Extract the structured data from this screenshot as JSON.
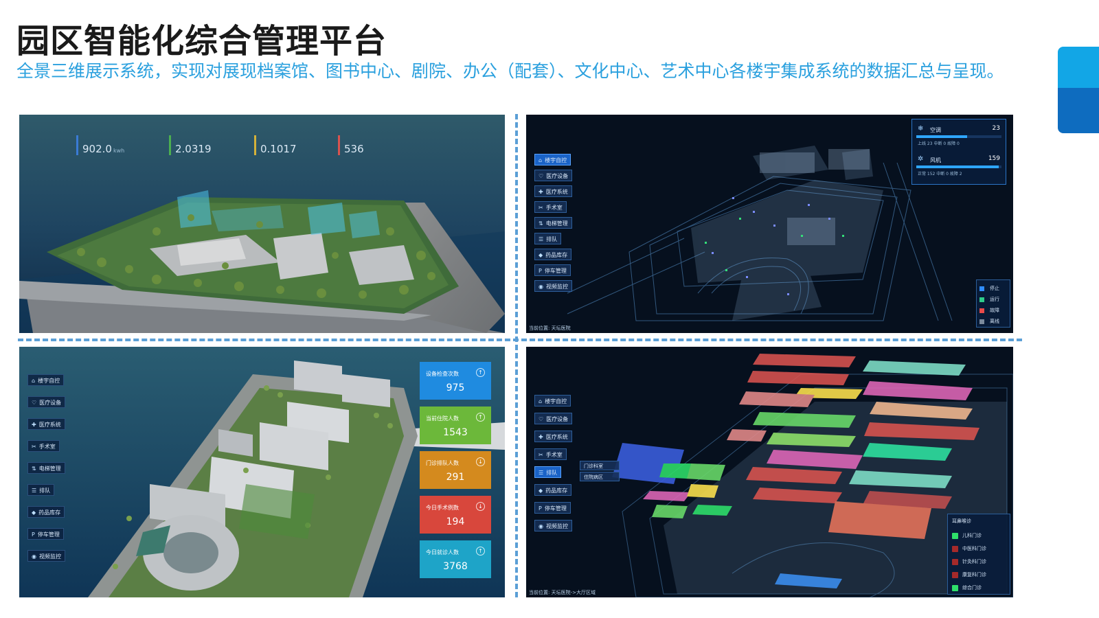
{
  "header": {
    "title": "园区智能化综合管理平台",
    "subtitle": "全景三维展示系统，实现对展现档案馆、图书中心、剧院、办公（配套）、文化中心、艺术中心各楼宇集成系统的数据汇总与呈现。"
  },
  "panel1": {
    "kpis": [
      {
        "label": "",
        "value": "902.0",
        "unit": "kwh",
        "color": "#3a7bd5"
      },
      {
        "label": "",
        "value": "2.0319",
        "unit": "",
        "color": "#4caf50"
      },
      {
        "label": "",
        "value": "0.1017",
        "unit": "",
        "color": "#d4b23a"
      },
      {
        "label": "",
        "value": "536",
        "unit": "",
        "color": "#d9534f"
      }
    ]
  },
  "panel2": {
    "menu": [
      {
        "label": "楼宇自控",
        "icon": "⌂",
        "active": true
      },
      {
        "label": "医疗设备",
        "icon": "♡",
        "active": false
      },
      {
        "label": "医疗系统",
        "icon": "✚",
        "active": false
      },
      {
        "label": "手术室",
        "icon": "✂",
        "active": false
      },
      {
        "label": "电梯管理",
        "icon": "⇅",
        "active": false
      },
      {
        "label": "排队",
        "icon": "☰",
        "active": false
      },
      {
        "label": "药品库存",
        "icon": "◆",
        "active": false
      },
      {
        "label": "停车管理",
        "icon": "P",
        "active": false
      },
      {
        "label": "视频监控",
        "icon": "◉",
        "active": false
      }
    ],
    "stats": [
      {
        "icon": "❄",
        "name": "空调",
        "value": "23",
        "fill": 0.6,
        "sub": "上线 23   中断 0   故障 0"
      },
      {
        "icon": "✲",
        "name": "风机",
        "value": "159",
        "fill": 0.97,
        "sub": "正常 152   中断 0   故障 2"
      }
    ],
    "legend": [
      {
        "label": "停止",
        "color": "#2f8cff"
      },
      {
        "label": "运行",
        "color": "#2ecc8a"
      },
      {
        "label": "故障",
        "color": "#e84a4a"
      },
      {
        "label": "离线",
        "color": "#7b8a9c"
      }
    ],
    "location": "当前位置:   天坛医院"
  },
  "panel3": {
    "menu": [
      {
        "label": "楼宇自控",
        "icon": "⌂"
      },
      {
        "label": "医疗设备",
        "icon": "♡"
      },
      {
        "label": "医疗系统",
        "icon": "✚"
      },
      {
        "label": "手术室",
        "icon": "✂"
      },
      {
        "label": "电梯管理",
        "icon": "⇅"
      },
      {
        "label": "排队",
        "icon": "☰"
      },
      {
        "label": "药品库存",
        "icon": "◆"
      },
      {
        "label": "停车管理",
        "icon": "P"
      },
      {
        "label": "视频监控",
        "icon": "◉"
      }
    ],
    "cards": [
      {
        "title": "设备检查次数",
        "value": "975",
        "color": "#1f8be0",
        "arrow": "↑"
      },
      {
        "title": "当前住院人数",
        "value": "1543",
        "color": "#6cb83a",
        "arrow": "↑"
      },
      {
        "title": "门诊排队人数",
        "value": "291",
        "color": "#d48a1e",
        "arrow": "↓"
      },
      {
        "title": "今日手术例数",
        "value": "194",
        "color": "#d8473c",
        "arrow": "↓"
      },
      {
        "title": "今日就诊人数",
        "value": "3768",
        "color": "#1ea4c8",
        "arrow": "↑"
      }
    ]
  },
  "panel4": {
    "menu": [
      {
        "label": "楼宇自控",
        "icon": "⌂",
        "active": false
      },
      {
        "label": "医疗设备",
        "icon": "♡",
        "active": false
      },
      {
        "label": "医疗系统",
        "icon": "✚",
        "active": false
      },
      {
        "label": "手术室",
        "icon": "✂",
        "active": false
      },
      {
        "label": "排队",
        "icon": "☰",
        "active": true
      },
      {
        "label": "药品库存",
        "icon": "◆",
        "active": false
      },
      {
        "label": "停车管理",
        "icon": "P",
        "active": false
      },
      {
        "label": "视频监控",
        "icon": "◉",
        "active": false
      }
    ],
    "submenu": [
      "门诊科室",
      "住院病区"
    ],
    "legend_title": "耳鼻喉诊",
    "legend": [
      {
        "label": "儿科门诊",
        "color": "#2ee06a"
      },
      {
        "label": "中医科门诊",
        "color": "#a52a2a"
      },
      {
        "label": "针灸科门诊",
        "color": "#a52a2a"
      },
      {
        "label": "康复科门诊",
        "color": "#a52a2a"
      },
      {
        "label": "综合门诊",
        "color": "#2ee06a"
      }
    ],
    "location": "当前位置:   天坛医院->大厅区域"
  }
}
